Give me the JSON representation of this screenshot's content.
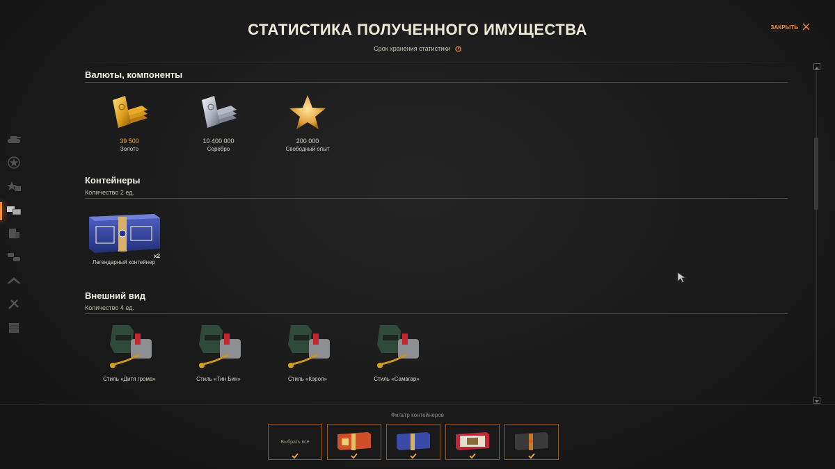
{
  "header": {
    "title": "СТАТИСТИКА ПОЛУЧЕННОГО ИМУЩЕСТВА",
    "subtitle": "Срок хранения статистики",
    "close_label": "ЗАКРЫТЬ"
  },
  "sidebar": {
    "items": [
      {
        "icon": "tank-icon"
      },
      {
        "icon": "star-badge-icon"
      },
      {
        "icon": "star-shapes-icon"
      },
      {
        "icon": "containers-icon",
        "active": true
      },
      {
        "icon": "building-icon"
      },
      {
        "icon": "vehicles-icon"
      },
      {
        "icon": "arrow-up-icon"
      },
      {
        "icon": "tools-icon"
      },
      {
        "icon": "misc-icon"
      }
    ]
  },
  "sections": {
    "currencies": {
      "title": "Валюты, компоненты",
      "items": [
        {
          "value": "39 500",
          "label": "Золото",
          "icon": "gold-bars-icon"
        },
        {
          "value": "10 400 000",
          "label": "Серебро",
          "icon": "silver-bars-icon"
        },
        {
          "value": "200 000",
          "label": "Свободный опыт",
          "icon": "star-icon"
        }
      ]
    },
    "containers": {
      "title": "Контейнеры",
      "count": "Количество 2 ед.",
      "items": [
        {
          "label": "Легендарный контейнер",
          "qty": "x2",
          "icon": "legendary-container-icon"
        }
      ]
    },
    "appearance": {
      "title": "Внешний вид",
      "count": "Количество 4 ед.",
      "items": [
        {
          "label": "Стиль «Дитя грома»",
          "icon": "welding-style-icon"
        },
        {
          "label": "Стиль «Тин Бин»",
          "icon": "welding-style-icon"
        },
        {
          "label": "Стиль «Кэрол»",
          "icon": "welding-style-icon"
        },
        {
          "label": "Стиль «Самвгар»",
          "icon": "welding-style-icon"
        }
      ]
    }
  },
  "filter": {
    "title": "Фильтр контейнеров",
    "select_all": "Выбрать все",
    "buttons": [
      {
        "icon": "red-container-icon"
      },
      {
        "icon": "blue-container-icon"
      },
      {
        "icon": "white-red-container-icon"
      },
      {
        "icon": "dark-container-icon"
      }
    ]
  },
  "colors": {
    "accent": "#f08a3c",
    "gold_value": "#f2a94b",
    "background": "#1b1b1b"
  }
}
